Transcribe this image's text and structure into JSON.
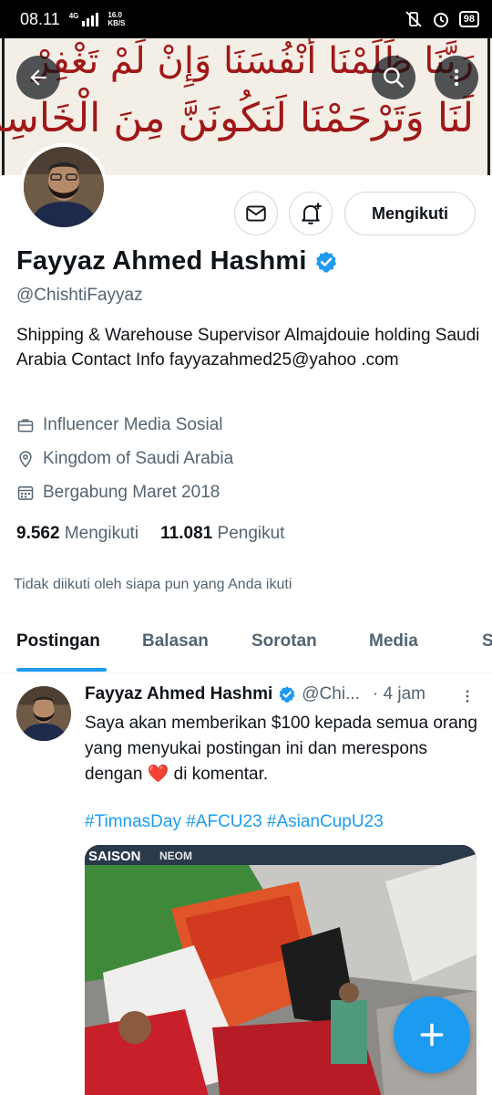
{
  "status_bar": {
    "time": "08.11",
    "network": "4G",
    "speed_value": "16.0",
    "speed_unit": "KB/S",
    "battery": "98"
  },
  "banner": {
    "line1": "رَبَّنَا ظَلَمْنَا أَنْفُسَنَا وَإِنْ لَمْ تَغْفِرْ",
    "line2": "لَنَا وَتَرْحَمْنَا لَنَكُونَنَّ مِنَ الْخَاسِرِينَ"
  },
  "profile": {
    "name": "Fayyaz Ahmed Hashmi",
    "handle": "@ChishtiFayyaz",
    "bio": "Shipping & Warehouse Supervisor Almajdouie holding Saudi Arabia  Contact Info fayyazahmed25@yahoo .com",
    "category": "Influencer Media Sosial",
    "location": "Kingdom of Saudi Arabia",
    "joined": "Bergabung Maret 2018",
    "following_count": "9.562",
    "following_label": "Mengikuti",
    "followers_count": "11.081",
    "followers_label": "Pengikut",
    "mutual_note": "Tidak diikuti oleh siapa pun yang Anda ikuti",
    "follow_button": "Mengikuti"
  },
  "tabs": [
    {
      "label": "Postingan"
    },
    {
      "label": "Balasan"
    },
    {
      "label": "Sorotan"
    },
    {
      "label": "Media"
    },
    {
      "label": "S"
    }
  ],
  "tweet": {
    "name": "Fayyaz Ahmed Hashmi",
    "handle": "@Chi...",
    "time": "· 4 jam",
    "text_before": "Saya akan memberikan $100 kepada semua orang yang menyukai postingan ini dan merespons dengan ",
    "emoji": "❤️",
    "text_after": " di komentar.",
    "hashtags": "#TimnasDay #AFCU23 #AsianCupU23",
    "media_brand": "SAISON",
    "media_sponsor": "NEOM"
  },
  "colors": {
    "accent": "#1d9bf0",
    "text": "#0f1419",
    "muted": "#536471",
    "verified": "#1d9bf0"
  },
  "icons": [
    "back-arrow-icon",
    "search-icon",
    "more-vertical-icon",
    "mail-icon",
    "bell-plus-icon",
    "verified-badge-icon",
    "briefcase-icon",
    "location-pin-icon",
    "calendar-icon",
    "compose-plus-icon"
  ]
}
